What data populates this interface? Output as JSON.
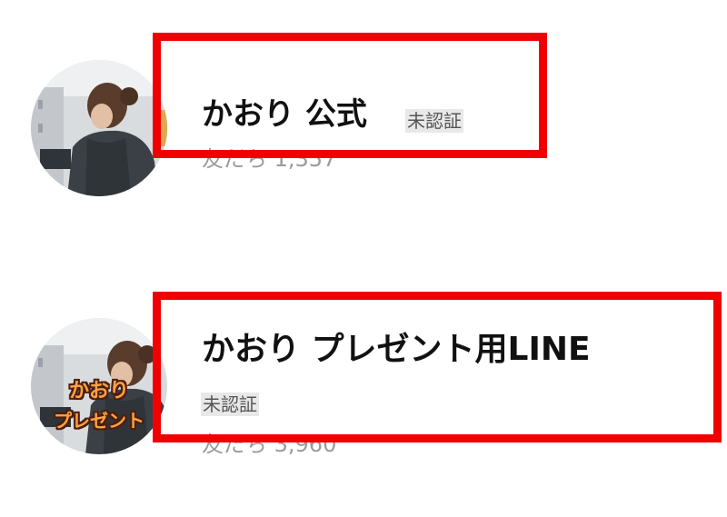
{
  "accounts": [
    {
      "name": "かおり 公式",
      "badge": "未認証",
      "friends": "友だち 1,357",
      "avatar_caption": []
    },
    {
      "name": "かおり プレゼント用LINE",
      "badge": "未認証",
      "friends": "友だち 3,960",
      "avatar_caption": [
        "かおり",
        "プレゼント"
      ]
    }
  ],
  "colors": {
    "highlight": "#f00000",
    "name_text": "#111111",
    "badge_bg": "#e8e8e8",
    "badge_text": "#555555",
    "friends_text": "#9a9a9a",
    "caption_text": "#ffa23f"
  }
}
